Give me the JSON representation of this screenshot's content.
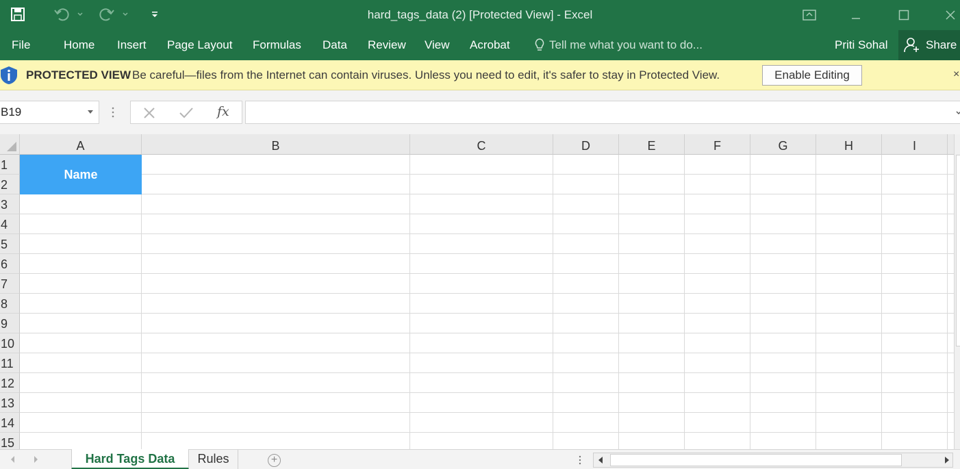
{
  "window": {
    "title": "hard_tags_data (2)  [Protected View] - Excel"
  },
  "ribbon": {
    "tabs": [
      "File",
      "Home",
      "Insert",
      "Page Layout",
      "Formulas",
      "Data",
      "Review",
      "View",
      "Acrobat"
    ],
    "tell_me_placeholder": "Tell me what you want to do...",
    "user_name": "Priti Sohal",
    "share_label": "Share"
  },
  "protected_view": {
    "label": "PROTECTED VIEW",
    "message": "Be careful—files from the Internet can contain viruses. Unless you need to edit, it's safer to stay in Protected View.",
    "enable_button": "Enable Editing",
    "close_symbol": "×"
  },
  "formula_bar": {
    "name_box": "B19",
    "fx_label": "fx",
    "formula": ""
  },
  "grid": {
    "columns": [
      "A",
      "B",
      "C",
      "D",
      "E",
      "F",
      "G",
      "H",
      "I"
    ],
    "rows": [
      "1",
      "2",
      "3",
      "4",
      "5",
      "6",
      "7",
      "8",
      "9",
      "10",
      "11",
      "12",
      "13",
      "14",
      "15"
    ],
    "header_cell": "Name"
  },
  "sheets": {
    "active": "Hard Tags Data",
    "other": "Rules",
    "add_symbol": "+"
  },
  "colors": {
    "excel_green": "#217346",
    "header_fill": "#3da5f4",
    "warning_bar": "#fcf7b6"
  }
}
